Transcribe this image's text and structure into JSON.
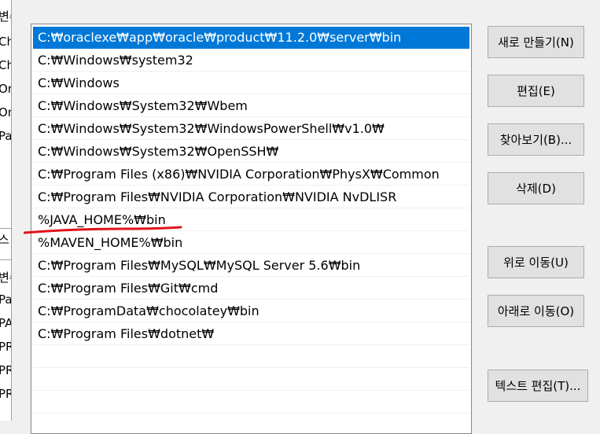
{
  "path_list": {
    "selected_index": 0,
    "entries": [
      "C:₩oraclexe₩app₩oracle₩product₩11.2.0₩server₩bin",
      "C:₩Windows₩system32",
      "C:₩Windows",
      "C:₩Windows₩System32₩Wbem",
      "C:₩Windows₩System32₩WindowsPowerShell₩v1.0₩",
      "C:₩Windows₩System32₩OpenSSH₩",
      "C:₩Program Files (x86)₩NVIDIA Corporation₩PhysX₩Common",
      "C:₩Program Files₩NVIDIA Corporation₩NVIDIA NvDLISR",
      "%JAVA_HOME%₩bin",
      "%MAVEN_HOME%₩bin",
      "C:₩Program Files₩MySQL₩MySQL Server 5.6₩bin",
      "C:₩Program Files₩Git₩cmd",
      "C:₩ProgramData₩chocolatey₩bin",
      "C:₩Program Files₩dotnet₩"
    ]
  },
  "buttons": {
    "new": "새로 만들기(N)",
    "edit": "편집(E)",
    "browse": "찾아보기(B)...",
    "delete": "삭제(D)",
    "move_up": "위로 이동(U)",
    "move_down": "아래로 이동(O)",
    "edit_text": "텍스트 편집(T)..."
  },
  "background_fragments": [
    "변수",
    "Ch",
    "Ch",
    "On",
    "On",
    "Pat",
    "스",
    "변수",
    "Pat",
    "PA",
    "PR",
    "PR",
    "PR"
  ],
  "colors": {
    "selection": "#0078d7",
    "annotation": "#e0141b",
    "button_face": "#e1e1e1"
  }
}
